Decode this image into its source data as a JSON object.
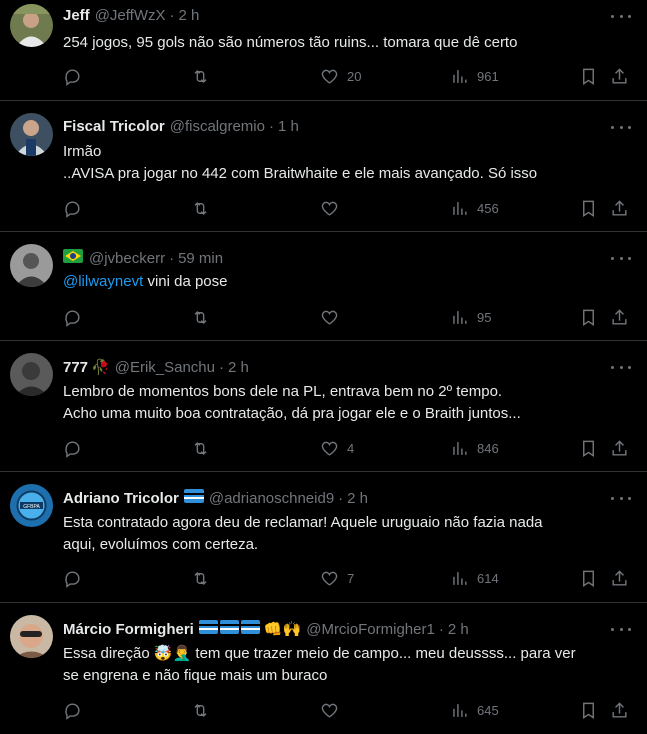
{
  "tweets": [
    {
      "name": "Jeff",
      "handle": "@JeffWzX",
      "sep": "·",
      "time": "2 h",
      "lines": [
        "254 jogos, 95 gols não são números tão ruins... tomara que dê certo"
      ],
      "replies": "",
      "retweets": "",
      "likes": "20",
      "views": "961",
      "avatar_color": "#7a8a5a"
    },
    {
      "name": "Fiscal Tricolor",
      "handle": "@fiscalgremio",
      "sep": "·",
      "time": "1 h",
      "lines": [
        "Irmão",
        "..AVISA pra jogar no 442 com Braitwhaite e ele mais avançado. Só isso"
      ],
      "replies": "",
      "retweets": "",
      "likes": "",
      "views": "456",
      "avatar_color": "#3a5a7a"
    },
    {
      "name": "",
      "flag": "brazil",
      "handle": "@jvbeckerr",
      "sep": "·",
      "time": "59 min",
      "mention": "@lilwaynevt",
      "lines": [
        "vini da pose"
      ],
      "replies": "",
      "retweets": "",
      "likes": "",
      "views": "95",
      "avatar_color": "#8a8a8a"
    },
    {
      "name": "777",
      "emoji": "🥀",
      "handle": "@Erik_Sanchu",
      "sep": "·",
      "time": "2 h",
      "lines": [
        "Lembro de momentos bons dele na PL, entrava bem no 2º tempo.",
        "Acho uma muito boa contratação, dá pra jogar ele e o Braith juntos..."
      ],
      "replies": "",
      "retweets": "",
      "likes": "4",
      "views": "846",
      "avatar_color": "#6a6a6a"
    },
    {
      "name": "Adriano Tricolor",
      "flag": "gremio",
      "handle": "@adrianoschneid9",
      "sep": "·",
      "time": "2 h",
      "lines": [
        "Esta contratado agora deu de reclamar! Aquele uruguaio não fazia nada",
        "aqui, evoluímos com certeza."
      ],
      "replies": "",
      "retweets": "",
      "likes": "7",
      "views": "614",
      "avatar_color": "#2b8fd6"
    },
    {
      "name": "Márcio Formigheri",
      "flag": "gremio3",
      "emoji": "👊🙌",
      "handle": "@MrcioFormigher1",
      "sep": "·",
      "time": "2 h",
      "lines": [
        "Essa direção 🤯🤦‍♂️ tem que trazer meio de campo... meu deussss... para ver",
        "se engrena e não fique mais um buraco"
      ],
      "replies": "",
      "retweets": "",
      "likes": "",
      "views": "645",
      "avatar_color": "#b89a80"
    }
  ],
  "icons": {
    "reply": "reply-icon",
    "retweet": "retweet-icon",
    "like": "heart-icon",
    "views": "views-icon",
    "bookmark": "bookmark-icon",
    "share": "share-icon",
    "more": "more-icon"
  }
}
